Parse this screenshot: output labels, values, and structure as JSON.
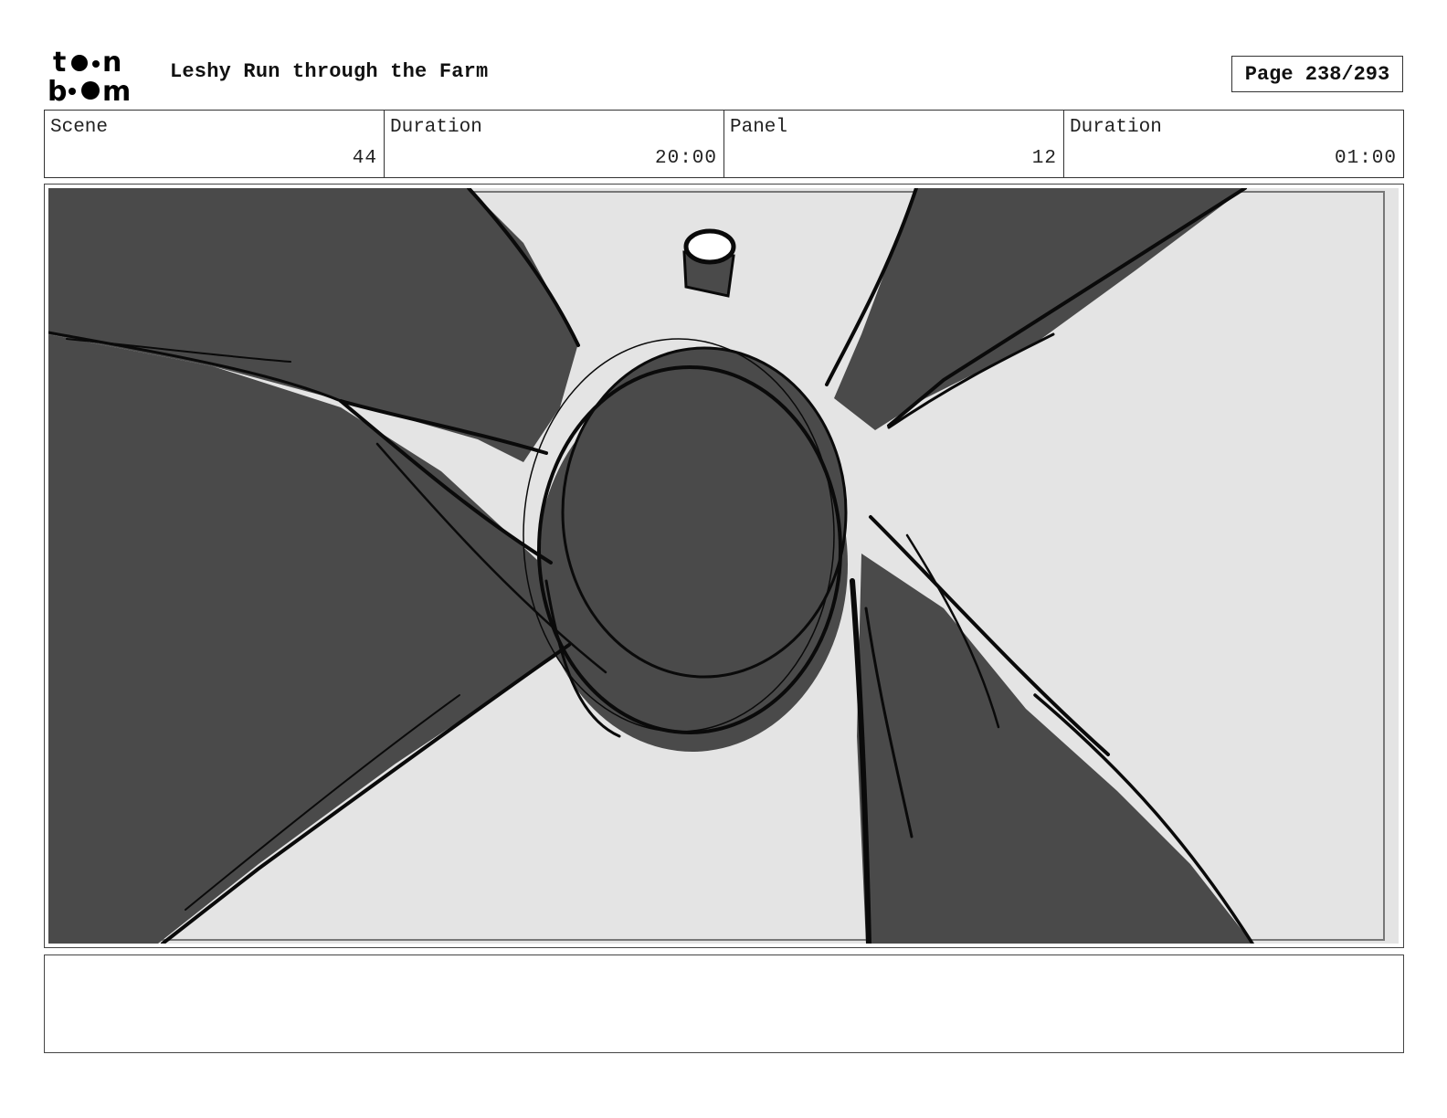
{
  "header": {
    "logo_text": "toon boom",
    "project_title": "Leshy Run through the Farm",
    "page_label": "Page 238/293"
  },
  "info": {
    "scene_label": "Scene",
    "scene_value": "44",
    "scene_duration_label": "Duration",
    "scene_duration_value": "20:00",
    "panel_label": "Panel",
    "panel_value": "12",
    "panel_duration_label": "Duration",
    "panel_duration_value": "01:00"
  },
  "colors": {
    "sketch_fill": "#4a4a4a",
    "sky": "#e4e4e4",
    "ink": "#0a0a0a"
  }
}
